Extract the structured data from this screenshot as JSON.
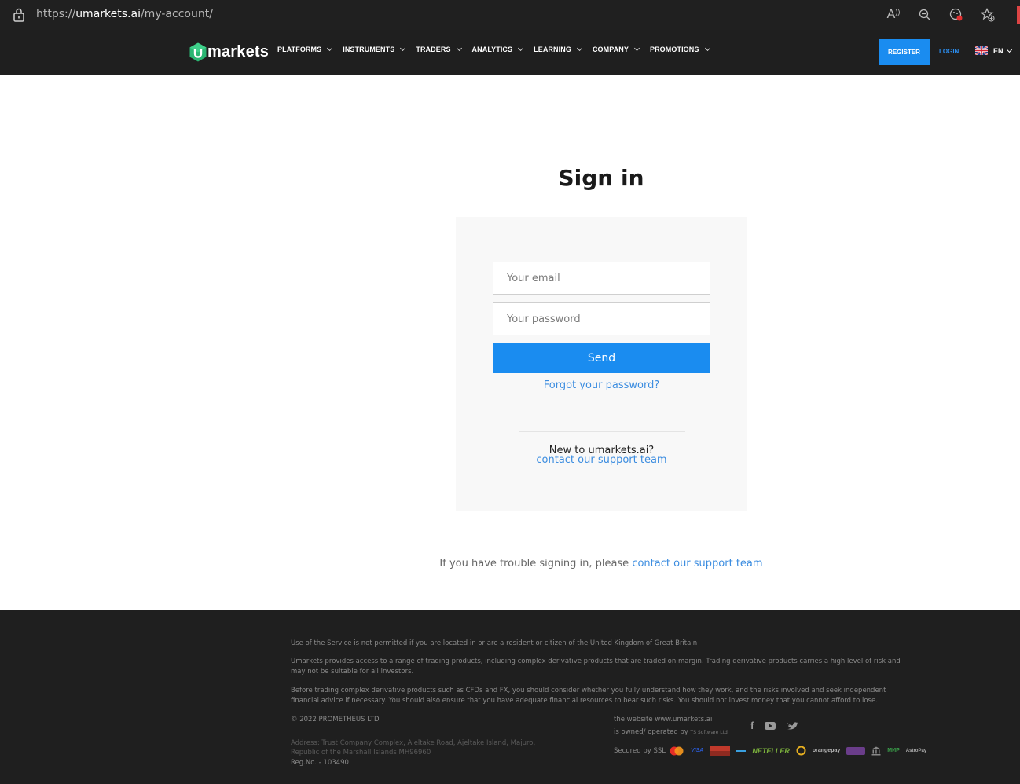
{
  "browser": {
    "url_scheme": "https://",
    "url_host": "umarkets.ai",
    "url_path": "/my-account/",
    "icons": [
      "lock-icon",
      "read-aloud-icon",
      "zoom-out-icon",
      "tracking-icon",
      "favorites-icon"
    ]
  },
  "header": {
    "logo_text": "markets",
    "nav": [
      {
        "label": "PLATFORMS"
      },
      {
        "label": "INSTRUMENTS"
      },
      {
        "label": "TRADERS"
      },
      {
        "label": "ANALYTICS"
      },
      {
        "label": "LEARNING"
      },
      {
        "label": "COMPANY"
      },
      {
        "label": "PROMOTIONS"
      }
    ],
    "register_label": "REGISTER",
    "login_label": "LOGIN",
    "lang_label": "EN"
  },
  "signin": {
    "title": "Sign in",
    "email_placeholder": "Your email",
    "password_placeholder": "Your password",
    "send_label": "Send",
    "forgot_label": "Forgot your password?",
    "new_text": "New to umarkets.ai?",
    "contact_label": "contact our support team",
    "trouble_text": "If you have trouble signing in, please ",
    "trouble_link": "contact our support team"
  },
  "footer": {
    "line1": "Use of the Service is not permitted if you are located in or are a resident or citizen of the United Kingdom of Great Britain",
    "line2": "Umarkets provides access to a range of trading products, including complex derivative products that are traded on margin. Trading derivative products carries a high level of risk and may not be suitable for all investors.",
    "line3": "Before trading complex derivative products such as CFDs and FX, you should consider whether you fully understand how they work, and the risks involved and seek independent financial advice if necessary. You should also ensure that you have adequate financial resources to bear such risks. You should not invest money that you cannot afford to lose.",
    "copyright": "© 2022 PROMETHEUS LTD",
    "address1": "Address: Trust Company Complex, Ajeltake Road, Ajeltake Island, Majuro,",
    "address2": "Republic of the Marshall Islands MH96960",
    "reg": "Reg.No. - 103490",
    "website": "the website www.umarkets.ai",
    "owned": "is owned/ operated by",
    "owner": "TS Software Ltd.",
    "ssl": "Secured by SSL",
    "payments": [
      "VISA",
      "NETELLER",
      "orangepay",
      "МИР",
      "AstroPay"
    ]
  }
}
